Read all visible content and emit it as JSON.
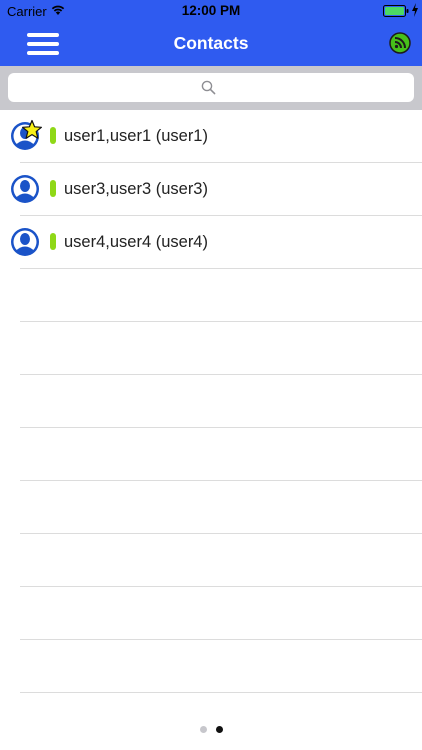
{
  "status_bar": {
    "carrier": "Carrier",
    "time": "12:00 PM"
  },
  "nav": {
    "title": "Contacts",
    "menu_icon": "hamburger-menu-icon",
    "right_icon": "rss-feed-icon"
  },
  "search": {
    "placeholder": "",
    "icon": "search-icon"
  },
  "contacts": [
    {
      "name": "user1,user1 (user1)",
      "favorite": true,
      "status": "online"
    },
    {
      "name": "user3,user3 (user3)",
      "favorite": false,
      "status": "online"
    },
    {
      "name": "user4,user4 (user4)",
      "favorite": false,
      "status": "online"
    }
  ],
  "page_indicator": {
    "count": 2,
    "current": 2
  },
  "colors": {
    "header": "#2f5bf0",
    "presence_online": "#8fd817",
    "avatar": "#1a53c8",
    "rss_icon": "#47c01a"
  }
}
